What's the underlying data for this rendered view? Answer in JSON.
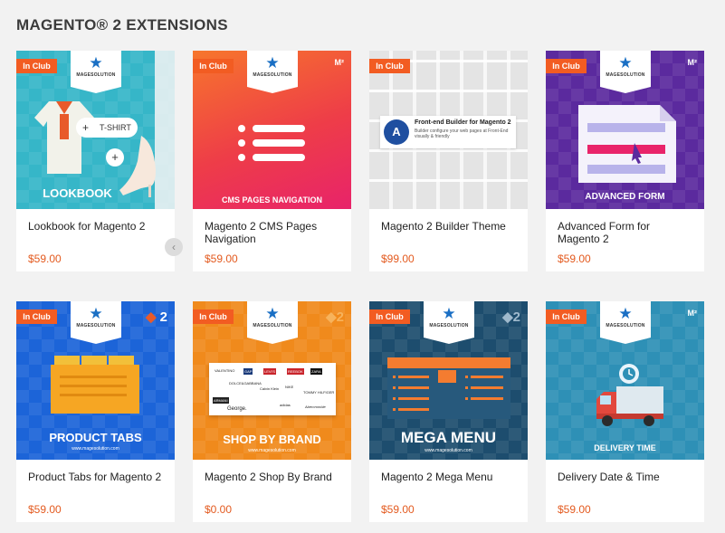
{
  "section_title": "MAGENTO® 2 EXTENSIONS",
  "badge_label": "In Club",
  "brand_logo_text": "MAGESOLUTION",
  "nav_arrow": "‹",
  "products": [
    {
      "name": "Lookbook for Magento 2",
      "price": "$59.00",
      "caption": "LOOKBOOK",
      "tag_text": "T-SHIRT",
      "bg": "#36b6c8",
      "m2": ""
    },
    {
      "name": "Magento 2 CMS Pages Navigation",
      "price": "$59.00",
      "caption": "CMS PAGES NAVIGATION",
      "bg": "#f0453d",
      "m2": "M²"
    },
    {
      "name": "Magento 2 Builder Theme",
      "price": "$99.00",
      "caption": "Front-end Builder for Magento 2",
      "subcaption": "Builder configure your web pages at Front-End visually & friendly",
      "bg": "#e8e8e8",
      "m2": ""
    },
    {
      "name": "Advanced Form for Magento 2",
      "price": "$59.00",
      "caption": "ADVANCED FORM",
      "bg": "#5b2a9e",
      "m2": "M²"
    },
    {
      "name": "Product Tabs for Magento 2",
      "price": "$59.00",
      "caption": "PRODUCT TABS",
      "url": "www.magesolution.com",
      "bg": "#1c64d8",
      "m2": "2"
    },
    {
      "name": "Magento 2 Shop By Brand",
      "price": "$0.00",
      "caption": "SHOP BY BRAND",
      "url": "www.magesolution.com",
      "bg": "#f08a1c",
      "m2": "2"
    },
    {
      "name": "Magento 2 Mega Menu",
      "price": "$59.00",
      "caption": "MEGA MENU",
      "url": "www.magesolution.com",
      "bg": "#1d4d6e",
      "m2": "2"
    },
    {
      "name": "Delivery Date & Time",
      "price": "$59.00",
      "caption": "DELIVERY TIME",
      "bg": "#2e90b6",
      "m2": "M²"
    }
  ],
  "brand_logos": [
    "VALENTINO",
    "GAP",
    "LEVI'S",
    "REEBOK",
    "ZARA",
    "DOLCE&GABBANA",
    "Calvin Klein",
    "NIKE",
    "",
    "",
    "ARMANI",
    "TOMMY HILFIGER",
    "George.",
    "adidas",
    "Abercrombie"
  ],
  "colors": {
    "accent": "#f25c22",
    "price": "#e35a1f",
    "background": "#f2f2f2"
  }
}
